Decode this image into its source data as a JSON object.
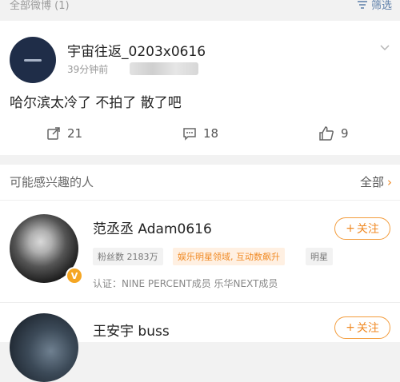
{
  "header": {
    "title": "全部微博 (1)",
    "filter_label": "筛选",
    "filter_icon": "filter-icon"
  },
  "post": {
    "username": "宇宙往返_0203x0616",
    "time": "39分钟前",
    "text": "哈尔滨太冷了 不拍了 散了吧",
    "repost_count": "21",
    "comment_count": "18",
    "like_count": "9"
  },
  "recommend": {
    "title": "可能感兴趣的人",
    "all_label": "全部",
    "users": [
      {
        "name": "范丞丞 Adam0616",
        "follow_label": "关注",
        "fans_label": "粉丝数",
        "fans_count": "2183万",
        "tag_orange": "娱乐明星领域, 互动数飙升",
        "tag_gray": "明星",
        "verify": "认证：NINE PERCENT成员 乐华NEXT成员",
        "badge": "V"
      },
      {
        "name": "王安宇 buss",
        "follow_label": "关注"
      }
    ]
  },
  "colors": {
    "accent": "#f08a24",
    "link": "#5b7da8"
  }
}
